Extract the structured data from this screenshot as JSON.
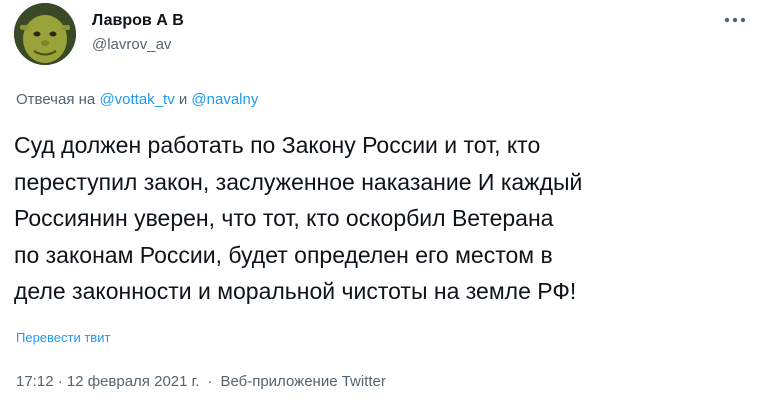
{
  "author": {
    "display_name": "Лавров А В",
    "handle": "@lavrov_av",
    "avatar_icon": "avatar-shrek-image"
  },
  "more_icon": "more-horizontal-icon",
  "reply": {
    "prefix": "Отвечая на ",
    "mention_1": "@vottak_tv",
    "conjunction": " и ",
    "mention_2": "@navalny"
  },
  "tweet": {
    "lines": [
      "Суд должен работать по Закону России и тот, кто",
      "переступил закон, заслуженное наказание И каждый",
      "Россиянин уверен, что тот, кто оскорбил Ветерана",
      "по законам России, будет определен его местом в",
      "деле законности и моральной чистоты на земле РФ!"
    ]
  },
  "translate_label": "Перевести твит",
  "meta": {
    "time": "17:12 · 12 февраля 2021 г.",
    "separator": "·",
    "source": "Веб-приложение Twitter"
  },
  "colors": {
    "text": "#0f1419",
    "secondary": "#536471",
    "link": "#1d9bf0"
  }
}
